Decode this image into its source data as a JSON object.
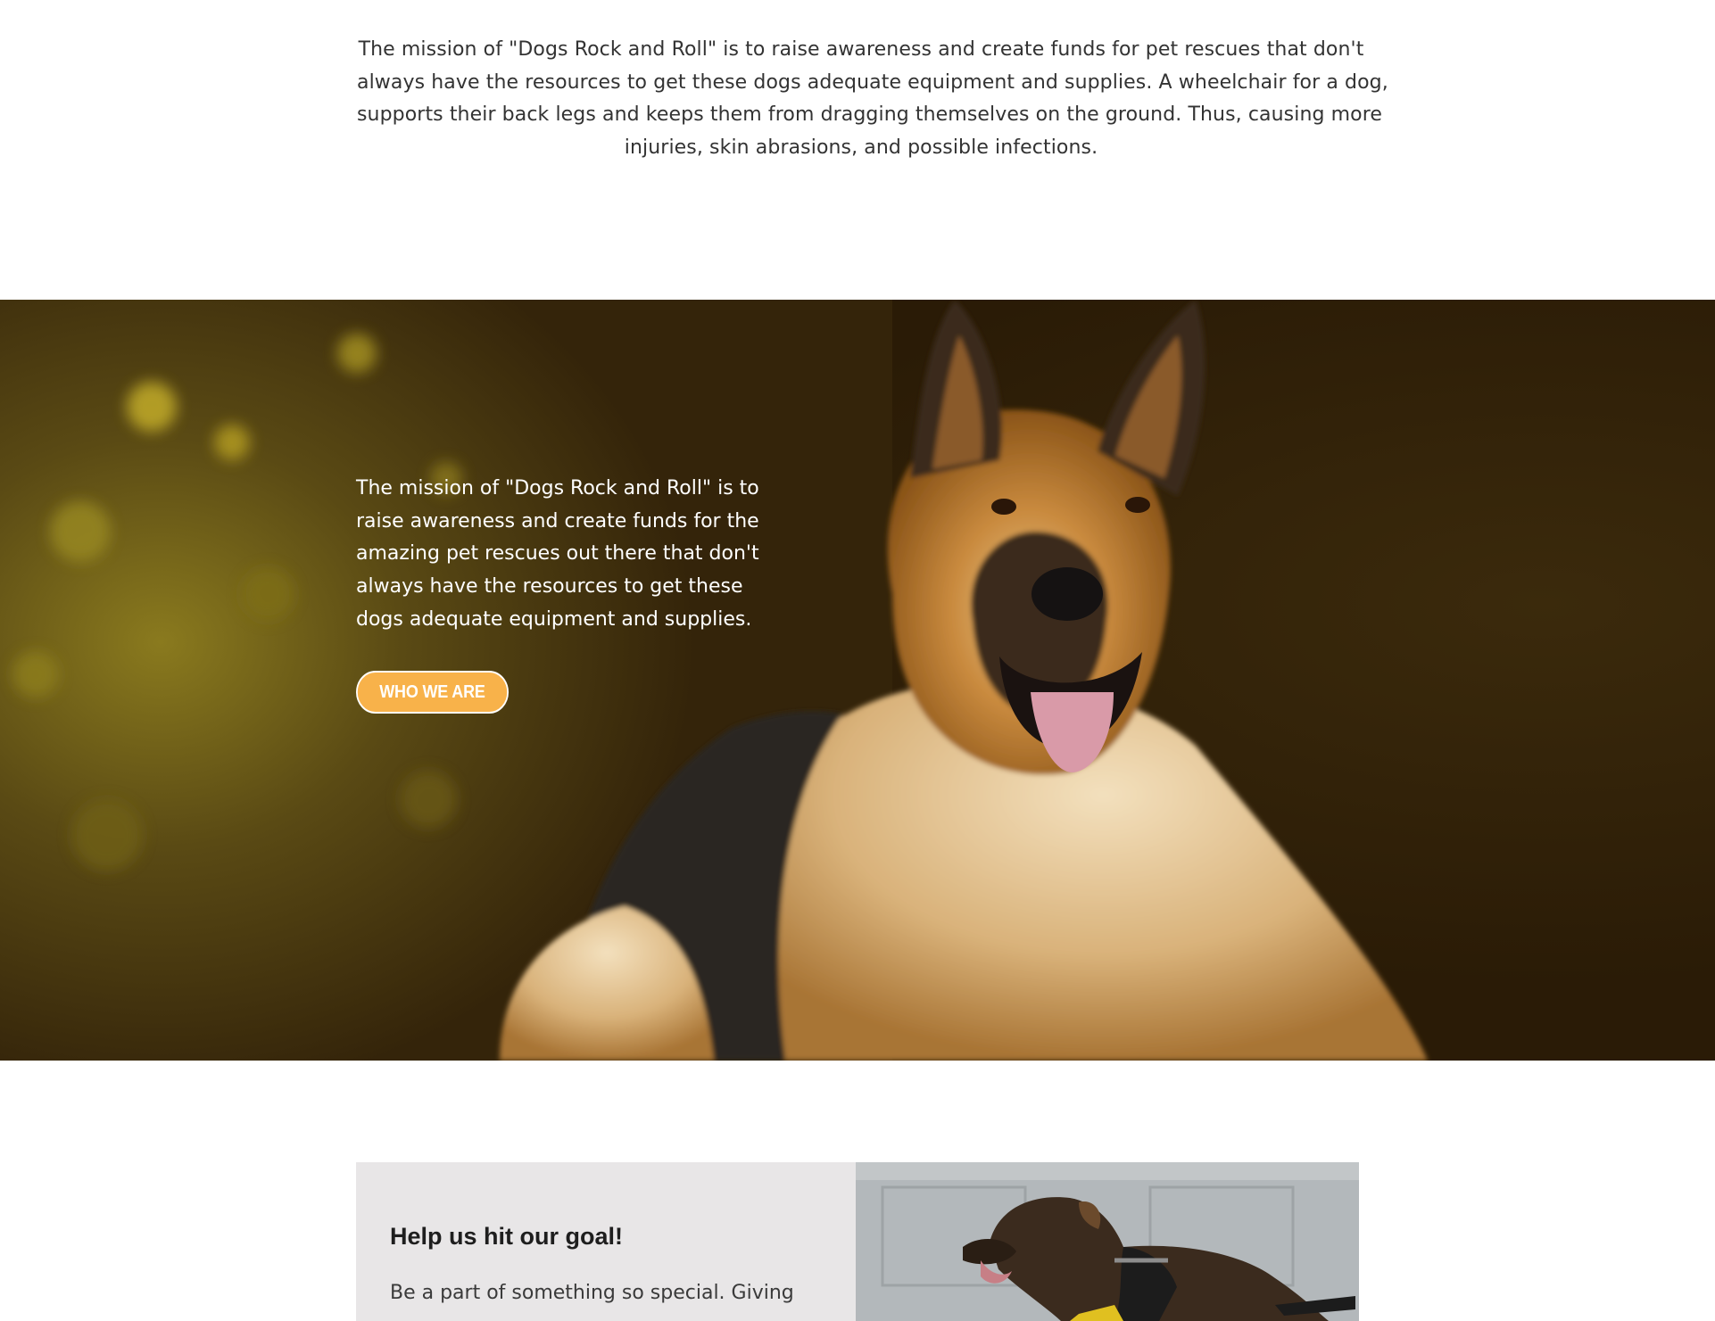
{
  "intro": {
    "lines": [
      "The mission of \"Dogs Rock and Roll\" is to raise awareness and create funds for pet rescues that don't",
      "always have the resources to get these dogs adequate equipment and supplies.  A wheelchair for a dog,",
      "supports their back legs and keeps them from dragging themselves on the ground. Thus, causing more",
      "injuries, skin abrasions, and possible infections."
    ]
  },
  "hero": {
    "lines": [
      "The mission of \"Dogs Rock and Roll\" is to",
      "raise awareness and create funds for the",
      "amazing pet rescues out there that don't",
      "always have the resources to get these",
      "dogs adequate equipment and supplies."
    ],
    "button_label": "WHO WE ARE",
    "button_color": "#f8b24a"
  },
  "goal": {
    "title": "Help us hit our goal!",
    "body": "Be a part of something so special. Giving"
  },
  "colors": {
    "background": "#ffffff",
    "goal_card": "#e8e6e7",
    "text": "#333333"
  }
}
